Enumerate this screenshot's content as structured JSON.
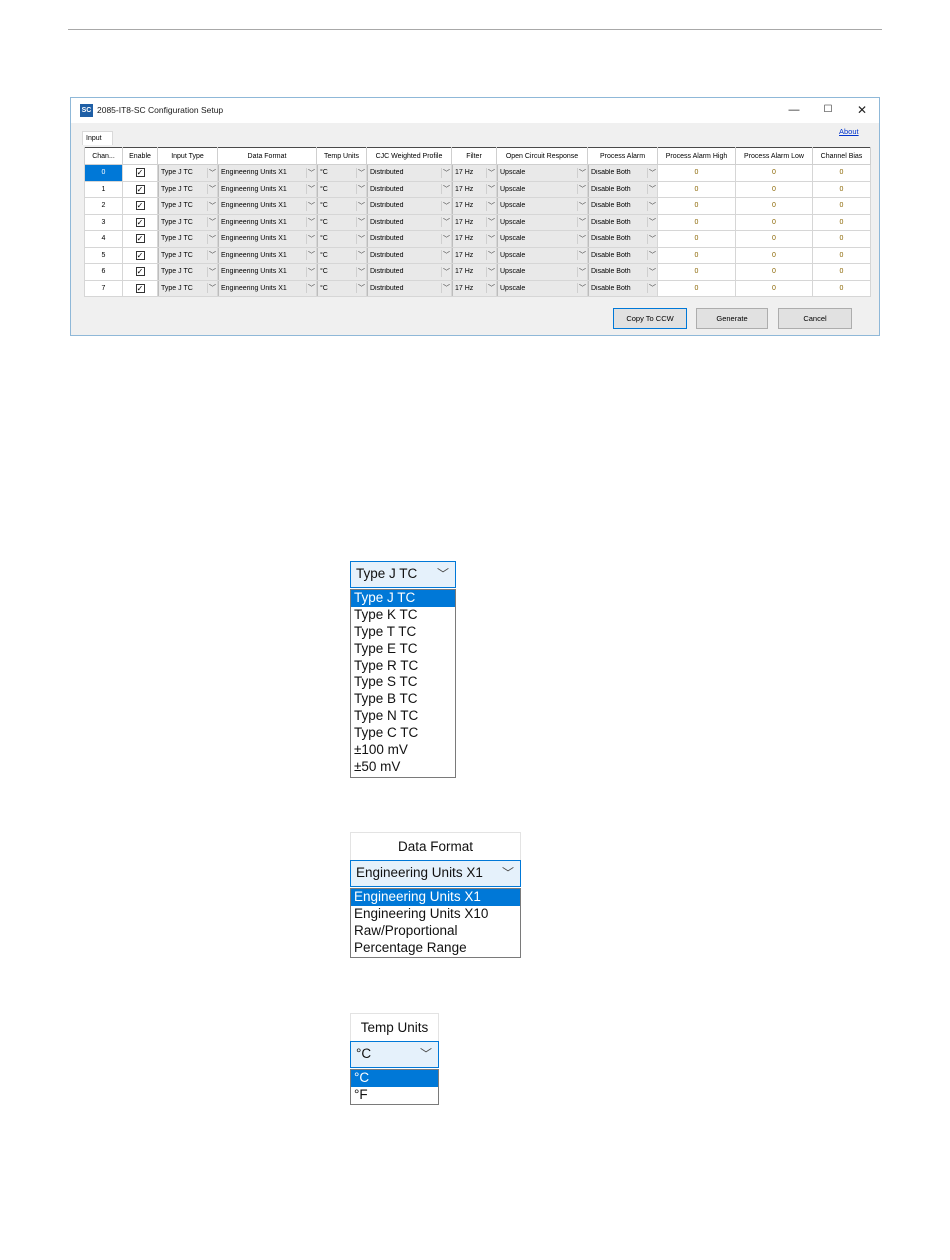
{
  "window": {
    "icon_label": "SC",
    "title": "2085-IT8-SC Configuration Setup",
    "minimize": "—",
    "maximize": "☐",
    "close": "✕",
    "tab_label": "Input",
    "about_link": "About"
  },
  "table": {
    "columns": [
      "Chan...",
      "Enable",
      "Input Type",
      "Data Format",
      "Temp Units",
      "CJC Weighted Profile",
      "Filter",
      "Open Circuit Response",
      "Process Alarm",
      "Process Alarm High",
      "Process Alarm Low",
      "Channel Bias"
    ],
    "rows": [
      {
        "chan": "0",
        "enable": "✓",
        "input_type": "Type J TC",
        "data_format": "Engineering Units X1",
        "temp_units": "°C",
        "cjc": "Distributed",
        "filter": "17 Hz",
        "open_circuit": "Upscale",
        "process_alarm": "Disable Both",
        "alarm_high": "0",
        "alarm_low": "0",
        "bias": "0"
      },
      {
        "chan": "1",
        "enable": "✓",
        "input_type": "Type J TC",
        "data_format": "Engineering Units X1",
        "temp_units": "°C",
        "cjc": "Distributed",
        "filter": "17 Hz",
        "open_circuit": "Upscale",
        "process_alarm": "Disable Both",
        "alarm_high": "0",
        "alarm_low": "0",
        "bias": "0"
      },
      {
        "chan": "2",
        "enable": "✓",
        "input_type": "Type J TC",
        "data_format": "Engineering Units X1",
        "temp_units": "°C",
        "cjc": "Distributed",
        "filter": "17 Hz",
        "open_circuit": "Upscale",
        "process_alarm": "Disable Both",
        "alarm_high": "0",
        "alarm_low": "0",
        "bias": "0"
      },
      {
        "chan": "3",
        "enable": "✓",
        "input_type": "Type J TC",
        "data_format": "Engineering Units X1",
        "temp_units": "°C",
        "cjc": "Distributed",
        "filter": "17 Hz",
        "open_circuit": "Upscale",
        "process_alarm": "Disable Both",
        "alarm_high": "0",
        "alarm_low": "0",
        "bias": "0"
      },
      {
        "chan": "4",
        "enable": "✓",
        "input_type": "Type J TC",
        "data_format": "Engineering Units X1",
        "temp_units": "°C",
        "cjc": "Distributed",
        "filter": "17 Hz",
        "open_circuit": "Upscale",
        "process_alarm": "Disable Both",
        "alarm_high": "0",
        "alarm_low": "0",
        "bias": "0"
      },
      {
        "chan": "5",
        "enable": "✓",
        "input_type": "Type J TC",
        "data_format": "Engineering Units X1",
        "temp_units": "°C",
        "cjc": "Distributed",
        "filter": "17 Hz",
        "open_circuit": "Upscale",
        "process_alarm": "Disable Both",
        "alarm_high": "0",
        "alarm_low": "0",
        "bias": "0"
      },
      {
        "chan": "6",
        "enable": "✓",
        "input_type": "Type J TC",
        "data_format": "Engineering Units X1",
        "temp_units": "°C",
        "cjc": "Distributed",
        "filter": "17 Hz",
        "open_circuit": "Upscale",
        "process_alarm": "Disable Both",
        "alarm_high": "0",
        "alarm_low": "0",
        "bias": "0"
      },
      {
        "chan": "7",
        "enable": "✓",
        "input_type": "Type J TC",
        "data_format": "Engineering Units X1",
        "temp_units": "°C",
        "cjc": "Distributed",
        "filter": "17 Hz",
        "open_circuit": "Upscale",
        "process_alarm": "Disable Both",
        "alarm_high": "0",
        "alarm_low": "0",
        "bias": "0"
      }
    ],
    "selected_row": "0"
  },
  "buttons": {
    "copy": "Copy To CCW",
    "generate": "Generate",
    "cancel": "Cancel"
  },
  "dropdown_chevron": "﹀",
  "input_type_dropdown": {
    "selected": "Type J TC",
    "options": [
      "Type J TC",
      "Type K TC",
      "Type T TC",
      "Type E TC",
      "Type R TC",
      "Type S TC",
      "Type B TC",
      "Type N TC",
      "Type C TC",
      "±100 mV",
      "±50 mV"
    ]
  },
  "data_format_dropdown": {
    "header": "Data Format",
    "selected": "Engineering Units X1",
    "options": [
      "Engineering Units X1",
      "Engineering Units X10",
      "Raw/Proportional",
      "Percentage Range"
    ]
  },
  "temp_units_dropdown": {
    "header": "Temp Units",
    "selected": "°C",
    "options": [
      "°C",
      "°F"
    ]
  },
  "colors": {
    "selection": "#0078d7",
    "window_border": "#8fb8d8",
    "value_text": "#8a6500"
  }
}
